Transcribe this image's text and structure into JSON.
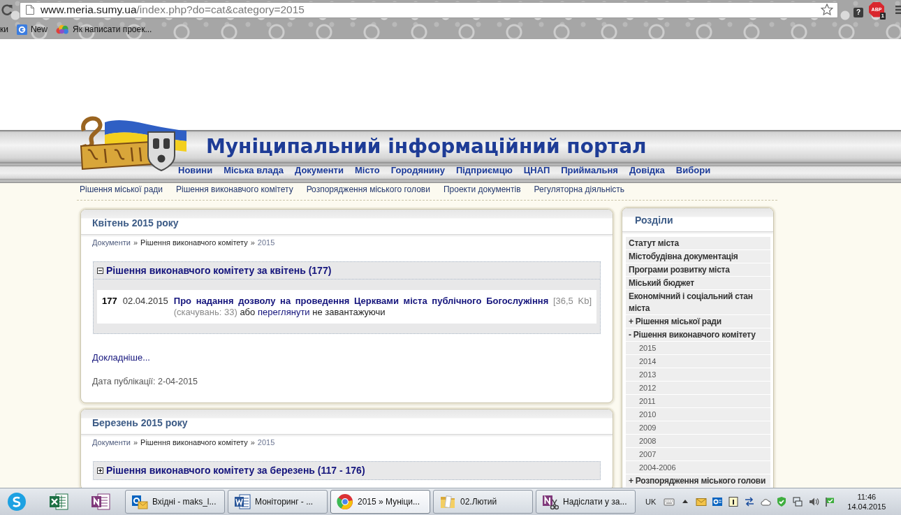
{
  "browser": {
    "url": {
      "host": "www.meria.sumy.ua",
      "path": "/index.php?do=cat&category=2015"
    },
    "extensions": [
      {
        "kind": "help",
        "label": "?"
      },
      {
        "kind": "adblock",
        "label": "ABP",
        "badge": "1"
      }
    ],
    "bookmarks": [
      {
        "kind": "plain",
        "label": "ки"
      },
      {
        "kind": "square",
        "label": "New"
      },
      {
        "kind": "cloud",
        "label": "Як написати проек..."
      }
    ]
  },
  "header": {
    "title": "Муніципальний інформаційний портал",
    "nav": [
      "Новини",
      "Міська влада",
      "Документи",
      "Місто",
      "Городянину",
      "Підприємцю",
      "ЦНАП",
      "Приймальня",
      "Довідка",
      "Вибори"
    ],
    "subnav": [
      "Рішення міської ради",
      "Рішення виконавчого комітету",
      "Розпорядження міського голови",
      "Проекти документів",
      "Регуляторна діяльність"
    ]
  },
  "articles": [
    {
      "title": "Квітень 2015 року",
      "breadcrumbs": [
        {
          "kind": "link",
          "label": "Документи"
        },
        {
          "kind": "section",
          "separator": "»",
          "label": "Рішення виконавчого комітету"
        },
        {
          "kind": "current",
          "separator": "»",
          "label": "2015"
        }
      ],
      "section": {
        "title": "Рішення виконавчого комітету за квітень (177)",
        "expanded": true,
        "documents": [
          {
            "number": "177",
            "date": "02.04.2015",
            "title": "Про надання дозволу на проведення Церквами міста публічного Богослужіння",
            "size": "[36,5 Kb]",
            "downloads": "(скачувань: 33)",
            "or": "або",
            "view_link": "переглянути",
            "view_note": "не завантажуючи"
          }
        ]
      },
      "more_link": "Докладніше...",
      "published": "Дата публікації: 2-04-2015"
    },
    {
      "title": "Березень 2015 року",
      "breadcrumbs": [
        {
          "kind": "link",
          "label": "Документи"
        },
        {
          "kind": "section",
          "separator": "»",
          "label": "Рішення виконавчого комітету"
        },
        {
          "kind": "current",
          "separator": "»",
          "label": "2015"
        }
      ],
      "section": {
        "title": "Рішення виконавчого комітету за березень (117 - 176)",
        "expanded": false
      }
    }
  ],
  "sidebar": {
    "title": "Розділи",
    "items": [
      {
        "label": "Статут міста"
      },
      {
        "label": "Містобудівна документація"
      },
      {
        "label": "Програми розвитку міста"
      },
      {
        "label": "Міський бюджет"
      },
      {
        "label": "Економічний і соціальний стан міста"
      },
      {
        "label": "+ Рішення міської ради"
      },
      {
        "label": "- Рішення виконавчого комітету",
        "children": [
          {
            "label": "2015"
          },
          {
            "label": "2014"
          },
          {
            "label": "2013"
          },
          {
            "label": "2012"
          },
          {
            "label": "2011"
          },
          {
            "label": "2010"
          },
          {
            "label": "2009"
          },
          {
            "label": "2008"
          },
          {
            "label": "2007"
          },
          {
            "label": "2004-2006"
          }
        ]
      },
      {
        "label": "+ Розпорядження міського голови"
      }
    ]
  },
  "taskbar": {
    "windows": [
      {
        "kind": "mail",
        "label": "Вхідні - maks_l...",
        "selected": false
      },
      {
        "kind": "document",
        "label": "Моніторинг - ...",
        "selected": false
      },
      {
        "kind": "browser",
        "label": "2015 » Муніци...",
        "selected": true
      },
      {
        "kind": "folder",
        "label": "02.Лютий",
        "selected": false
      },
      {
        "kind": "notebook",
        "label": "Надіслати у за...",
        "selected": false
      }
    ],
    "language": "UK",
    "time": "11:46",
    "date": "14.04.2015"
  }
}
